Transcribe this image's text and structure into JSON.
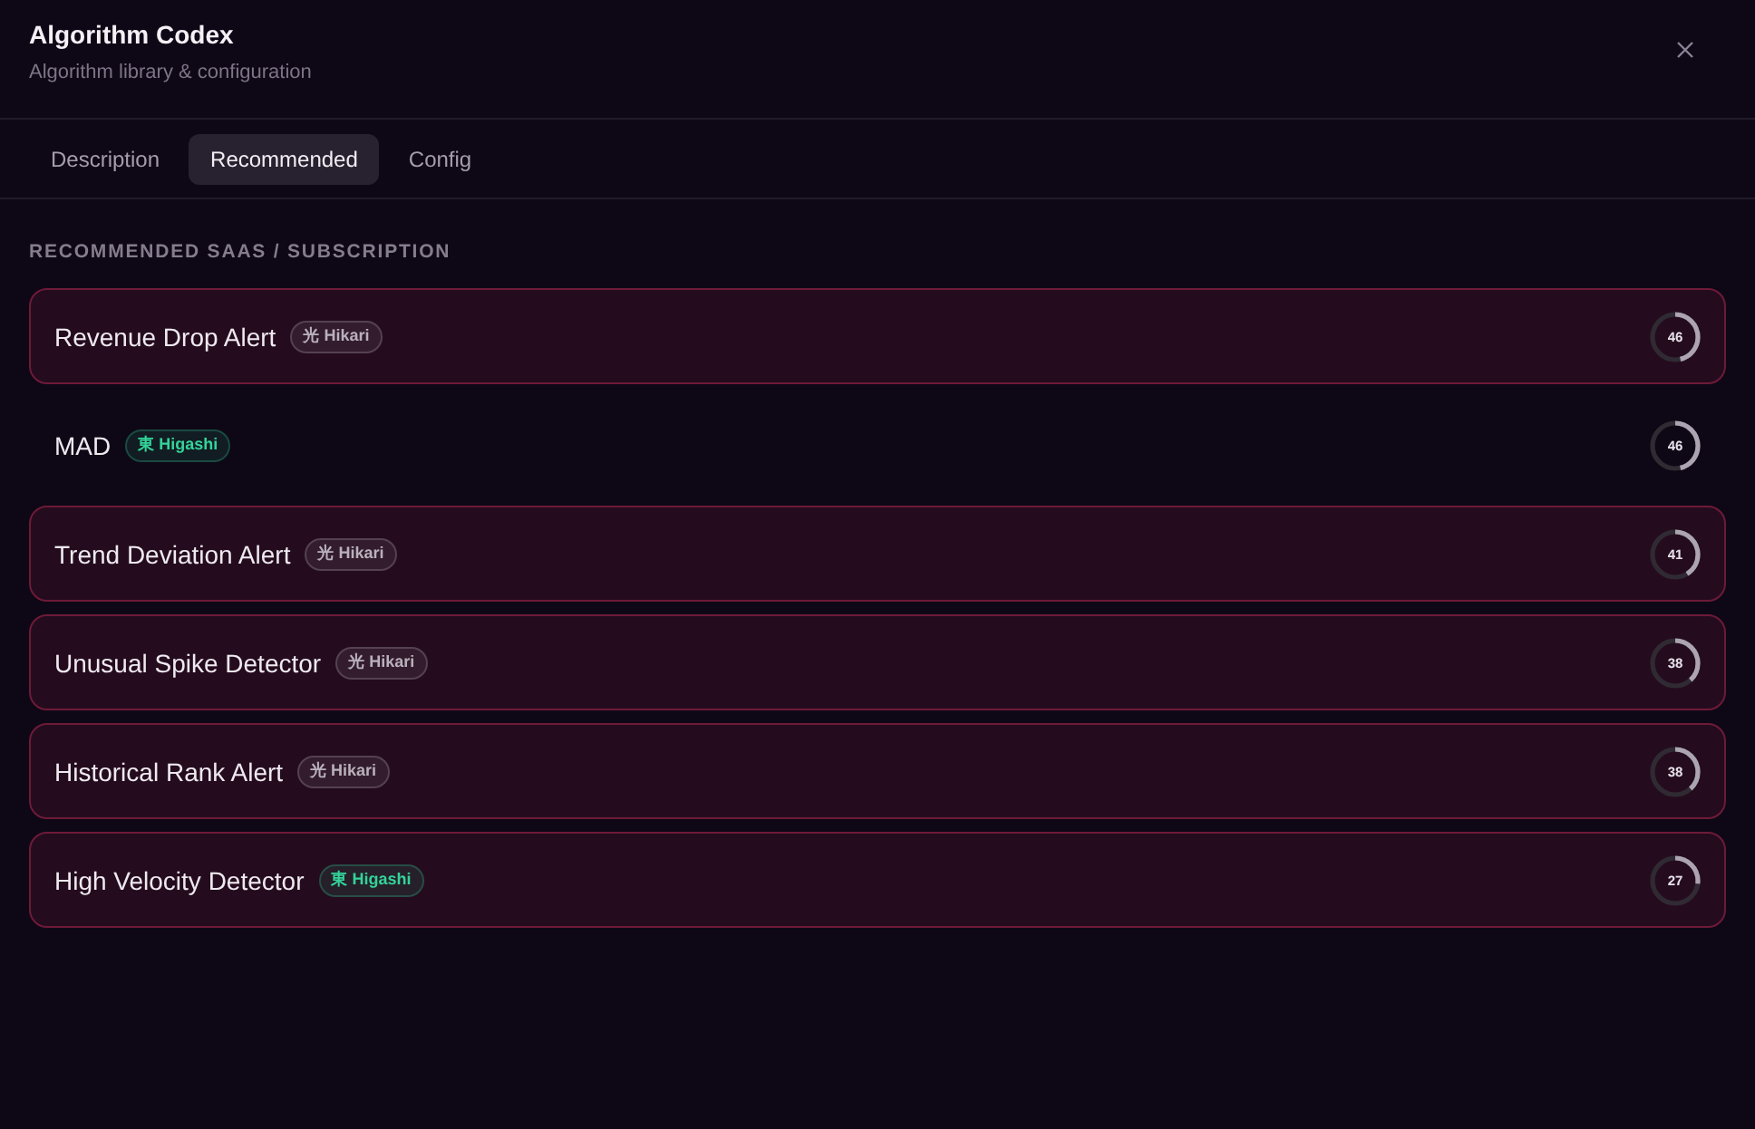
{
  "window": {
    "title": "Algorithm Codex",
    "subtitle": "Algorithm library & configuration"
  },
  "tabs": [
    {
      "label": "Description",
      "selected": false
    },
    {
      "label": "Recommended",
      "selected": true
    },
    {
      "label": "Config",
      "selected": false
    }
  ],
  "section": {
    "heading": "RECOMMENDED SAAS / SUBSCRIPTION"
  },
  "rows": [
    {
      "name": "Revenue Drop Alert",
      "highlighted": true,
      "tag": {
        "label": "光 Hikari",
        "color": "#b9b1bd"
      },
      "score": "46",
      "level": 0.46
    },
    {
      "name": "MAD",
      "highlighted": false,
      "tag": {
        "label": "東 Higashi",
        "color": "#34d399"
      },
      "score": "46",
      "level": 0.46
    },
    {
      "name": "Trend Deviation Alert",
      "highlighted": true,
      "tag": {
        "label": "光 Hikari",
        "color": "#b9b1bd"
      },
      "score": "41",
      "level": 0.41
    },
    {
      "name": "Unusual Spike Detector",
      "highlighted": true,
      "tag": {
        "label": "光 Hikari",
        "color": "#b9b1bd"
      },
      "score": "38",
      "level": 0.38
    },
    {
      "name": "Historical Rank Alert",
      "highlighted": true,
      "tag": {
        "label": "光 Hikari",
        "color": "#b9b1bd"
      },
      "score": "38",
      "level": 0.38
    },
    {
      "name": "High Velocity Detector",
      "highlighted": true,
      "tag": {
        "label": "東 Higashi",
        "color": "#34d399"
      },
      "score": "27",
      "level": 0.27
    }
  ]
}
